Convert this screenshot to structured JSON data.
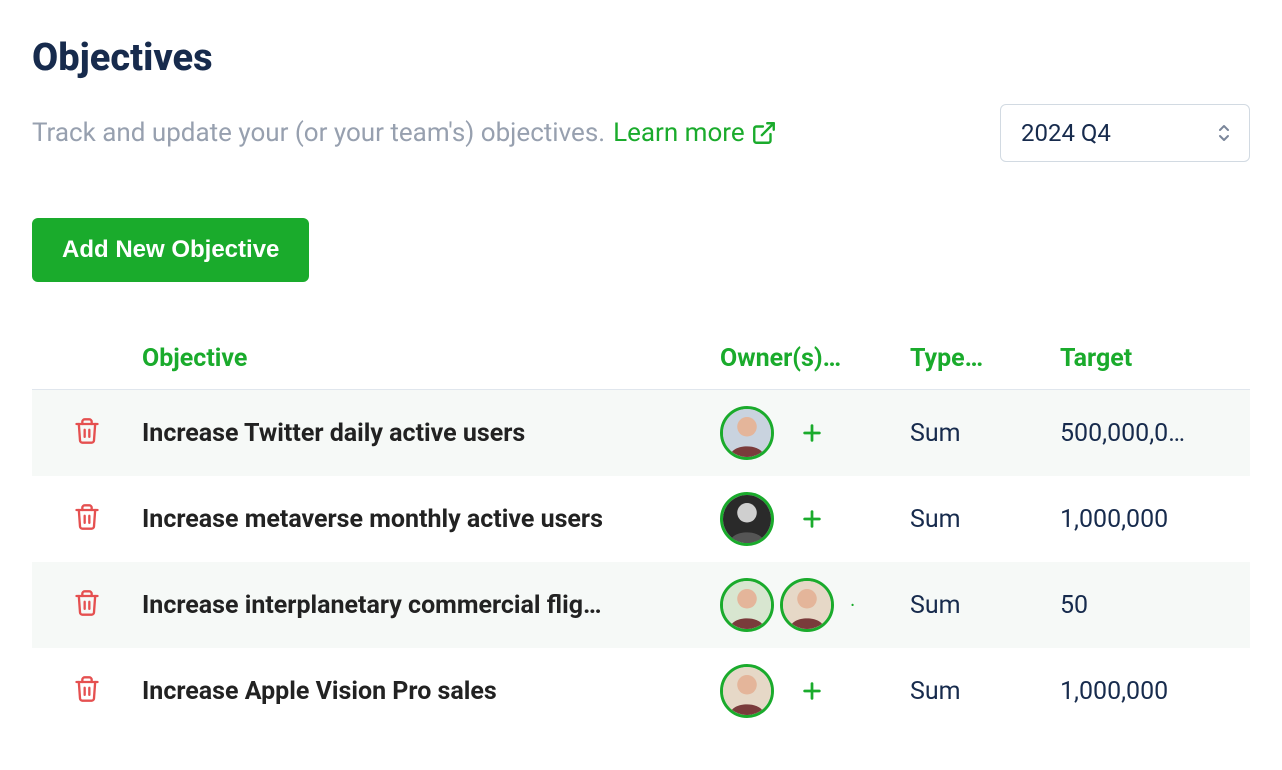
{
  "header": {
    "title": "Objectives",
    "subtitle": "Track and update your (or your team's) objectives.",
    "learn_more_label": "Learn more",
    "period_selected": "2024 Q4"
  },
  "actions": {
    "add_button_label": "Add New Objective"
  },
  "table": {
    "columns": {
      "objective": "Objective",
      "owners": "Owner(s)…",
      "type": "Type…",
      "target": "Target"
    },
    "rows": [
      {
        "objective": "Increase Twitter daily active users",
        "owners_count": 1,
        "show_plus": true,
        "show_more": false,
        "type": "Sum",
        "target": "500,000,0…"
      },
      {
        "objective": "Increase metaverse monthly active users",
        "owners_count": 1,
        "show_plus": true,
        "show_more": false,
        "type": "Sum",
        "target": "1,000,000"
      },
      {
        "objective": "Increase interplanetary commercial flig…",
        "owners_count": 2,
        "show_plus": false,
        "show_more": true,
        "type": "Sum",
        "target": "50"
      },
      {
        "objective": "Increase Apple Vision Pro sales",
        "owners_count": 1,
        "show_plus": true,
        "show_more": false,
        "type": "Sum",
        "target": "1,000,000"
      }
    ]
  }
}
